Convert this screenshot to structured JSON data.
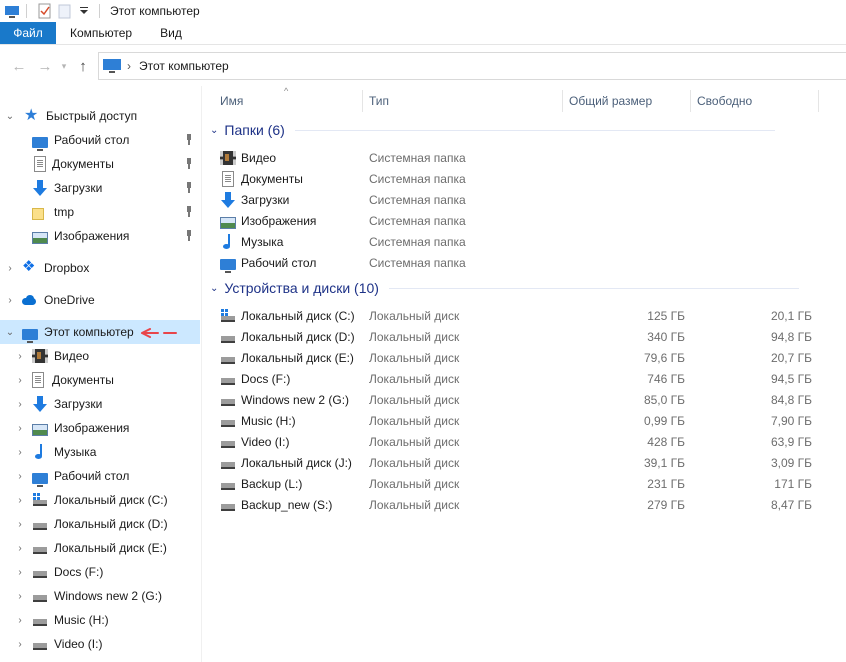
{
  "window": {
    "title": "Этот компьютер"
  },
  "ribbon": {
    "tabs": [
      "Файл",
      "Компьютер",
      "Вид"
    ]
  },
  "address": {
    "path": "Этот компьютер",
    "up_icon": "up-arrow-icon",
    "back_icon": "back-arrow-icon",
    "forward_icon": "forward-arrow-icon"
  },
  "nav": {
    "quick_access": {
      "label": "Быстрый доступ",
      "items": [
        {
          "label": "Рабочий стол",
          "icon": "desktop-icon",
          "pinned": true
        },
        {
          "label": "Документы",
          "icon": "documents-icon",
          "pinned": true
        },
        {
          "label": "Загрузки",
          "icon": "downloads-icon",
          "pinned": true
        },
        {
          "label": "tmp",
          "icon": "folder-icon",
          "pinned": true
        },
        {
          "label": "Изображения",
          "icon": "pictures-icon",
          "pinned": true
        }
      ]
    },
    "dropbox": {
      "label": "Dropbox"
    },
    "onedrive": {
      "label": "OneDrive"
    },
    "this_pc": {
      "label": "Этот компьютер",
      "items": [
        {
          "label": "Видео",
          "icon": "video-icon"
        },
        {
          "label": "Документы",
          "icon": "documents-icon"
        },
        {
          "label": "Загрузки",
          "icon": "downloads-icon"
        },
        {
          "label": "Изображения",
          "icon": "pictures-icon"
        },
        {
          "label": "Музыка",
          "icon": "music-icon"
        },
        {
          "label": "Рабочий стол",
          "icon": "desktop-icon"
        },
        {
          "label": "Локальный диск (C:)",
          "icon": "system-disk-icon"
        },
        {
          "label": "Локальный диск (D:)",
          "icon": "disk-icon"
        },
        {
          "label": "Локальный диск (E:)",
          "icon": "disk-icon"
        },
        {
          "label": "Docs (F:)",
          "icon": "disk-icon"
        },
        {
          "label": "Windows new 2 (G:)",
          "icon": "disk-icon"
        },
        {
          "label": "Music (H:)",
          "icon": "disk-icon"
        },
        {
          "label": "Video (I:)",
          "icon": "disk-icon"
        }
      ]
    }
  },
  "columns": {
    "name": "Имя",
    "type": "Тип",
    "total": "Общий размер",
    "free": "Свободно"
  },
  "groups": {
    "folders": {
      "label": "Папки (6)",
      "items": [
        {
          "name": "Видео",
          "type": "Системная папка",
          "icon": "video-icon"
        },
        {
          "name": "Документы",
          "type": "Системная папка",
          "icon": "documents-icon"
        },
        {
          "name": "Загрузки",
          "type": "Системная папка",
          "icon": "downloads-icon"
        },
        {
          "name": "Изображения",
          "type": "Системная папка",
          "icon": "pictures-icon"
        },
        {
          "name": "Музыка",
          "type": "Системная папка",
          "icon": "music-icon"
        },
        {
          "name": "Рабочий стол",
          "type": "Системная папка",
          "icon": "desktop-icon"
        }
      ]
    },
    "drives": {
      "label": "Устройства и диски (10)",
      "items": [
        {
          "name": "Локальный диск (C:)",
          "type": "Локальный диск",
          "total": "125 ГБ",
          "free": "20,1 ГБ",
          "icon": "system-disk-icon"
        },
        {
          "name": "Локальный диск (D:)",
          "type": "Локальный диск",
          "total": "340 ГБ",
          "free": "94,8 ГБ",
          "icon": "disk-icon"
        },
        {
          "name": "Локальный диск (E:)",
          "type": "Локальный диск",
          "total": "79,6 ГБ",
          "free": "20,7 ГБ",
          "icon": "disk-icon"
        },
        {
          "name": "Docs (F:)",
          "type": "Локальный диск",
          "total": "746 ГБ",
          "free": "94,5 ГБ",
          "icon": "disk-icon"
        },
        {
          "name": "Windows new 2 (G:)",
          "type": "Локальный диск",
          "total": "85,0 ГБ",
          "free": "84,8 ГБ",
          "icon": "disk-icon"
        },
        {
          "name": "Music (H:)",
          "type": "Локальный диск",
          "total": "0,99 ГБ",
          "free": "7,90 ГБ",
          "icon": "disk-icon"
        },
        {
          "name": "Video (I:)",
          "type": "Локальный диск",
          "total": "428 ГБ",
          "free": "63,9 ГБ",
          "icon": "disk-icon"
        },
        {
          "name": "Локальный диск (J:)",
          "type": "Локальный диск",
          "total": "39,1 ГБ",
          "free": "3,09 ГБ",
          "icon": "disk-icon"
        },
        {
          "name": "Backup (L:)",
          "type": "Локальный диск",
          "total": "231 ГБ",
          "free": "171 ГБ",
          "icon": "disk-icon"
        },
        {
          "name": "Backup_new (S:)",
          "type": "Локальный диск",
          "total": "279 ГБ",
          "free": "8,47 ГБ",
          "icon": "disk-icon"
        }
      ]
    }
  },
  "colors": {
    "accent": "#1979ca",
    "selection": "#cce8ff",
    "group_header": "#1e3287",
    "annotation_arrow": "#e8454a"
  }
}
